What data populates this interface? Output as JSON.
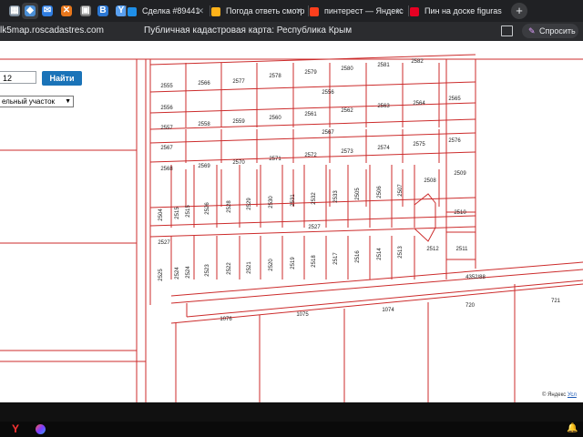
{
  "browser": {
    "pinned_tabs": [
      {
        "icon": "grid-icon",
        "glyph": "▦",
        "color": "#7a8a99"
      },
      {
        "icon": "active-tab-icon",
        "glyph": "◆",
        "color": "#4b8fd6"
      },
      {
        "icon": "mail-icon",
        "glyph": "✉",
        "color": "#2f7de1"
      },
      {
        "icon": "tools-icon",
        "glyph": "✕",
        "color": "#e8771c"
      },
      {
        "icon": "window-icon",
        "glyph": "▣",
        "color": "#777777"
      },
      {
        "icon": "vk-icon",
        "glyph": "B",
        "color": "#2c78d4"
      },
      {
        "icon": "y-icon",
        "glyph": "Y",
        "color": "#5aa0f0"
      }
    ],
    "tabs": [
      {
        "label": "Сделка #89441",
        "icon": "deal-icon",
        "color": "#1f8fe8"
      },
      {
        "label": "Погода ответь смотр",
        "icon": "weather-icon",
        "color": "#ffb21a"
      },
      {
        "label": "пинтерест — Яндекс",
        "icon": "yandex-icon",
        "color": "#fc3f1d"
      },
      {
        "label": "Пин на доске figuras",
        "icon": "pinterest-icon",
        "color": "#e60023"
      }
    ],
    "new_tab": "+",
    "url": "lk5map.roscadastres.com",
    "page_title": "Публичная кадастровая карта: Республика Крым",
    "ask_button": "Спросить"
  },
  "map": {
    "search_value": "12",
    "search_button": "Найти",
    "type_select": "ельный участок",
    "parcels": [
      {
        "label": "2582"
      },
      {
        "label": "2555"
      },
      {
        "label": "2566"
      },
      {
        "label": "2577"
      },
      {
        "label": "2578"
      },
      {
        "label": "2579"
      },
      {
        "label": "2580"
      },
      {
        "label": "2581"
      },
      {
        "label": "2556"
      },
      {
        "label": "2556"
      },
      {
        "label": "2557"
      },
      {
        "label": "2558"
      },
      {
        "label": "2559"
      },
      {
        "label": "2560"
      },
      {
        "label": "2561"
      },
      {
        "label": "2562"
      },
      {
        "label": "2563"
      },
      {
        "label": "2564"
      },
      {
        "label": "2565"
      },
      {
        "label": "2567"
      },
      {
        "label": "2567"
      },
      {
        "label": "2568"
      },
      {
        "label": "2569"
      },
      {
        "label": "2570"
      },
      {
        "label": "2571"
      },
      {
        "label": "2572"
      },
      {
        "label": "2573"
      },
      {
        "label": "2574"
      },
      {
        "label": "2575"
      },
      {
        "label": "2576"
      },
      {
        "label": "2508"
      },
      {
        "label": "2509"
      },
      {
        "label": "2510"
      },
      {
        "label": "2504"
      },
      {
        "label": "2515"
      },
      {
        "label": "2515"
      },
      {
        "label": "2526"
      },
      {
        "label": "2528"
      },
      {
        "label": "2529"
      },
      {
        "label": "2530"
      },
      {
        "label": "2531"
      },
      {
        "label": "2532"
      },
      {
        "label": "2533"
      },
      {
        "label": "2505"
      },
      {
        "label": "2506"
      },
      {
        "label": "2507"
      },
      {
        "label": "2527"
      },
      {
        "label": "2527"
      },
      {
        "label": "2525"
      },
      {
        "label": "2524"
      },
      {
        "label": "2524"
      },
      {
        "label": "2523"
      },
      {
        "label": "2522"
      },
      {
        "label": "2521"
      },
      {
        "label": "2520"
      },
      {
        "label": "2519"
      },
      {
        "label": "2518"
      },
      {
        "label": "2517"
      },
      {
        "label": "2516"
      },
      {
        "label": "2514"
      },
      {
        "label": "2513"
      },
      {
        "label": "2512"
      },
      {
        "label": "2511"
      },
      {
        "label": "4352/88"
      },
      {
        "label": "1076"
      },
      {
        "label": "1075"
      },
      {
        "label": "1074"
      },
      {
        "label": "720"
      },
      {
        "label": "721"
      }
    ],
    "attribution_prefix": "© Яндекс",
    "attribution_terms": "Усл"
  },
  "taskbar": {
    "start": "Y"
  }
}
